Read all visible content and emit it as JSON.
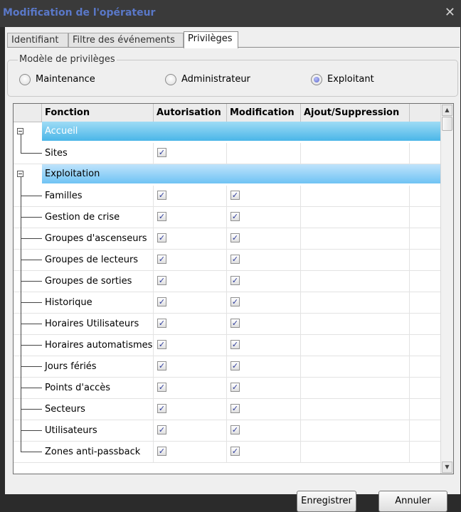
{
  "window": {
    "title": "Modification de l'opérateur"
  },
  "tabs": [
    {
      "label": "Identifiant"
    },
    {
      "label": "Filtre des événements"
    },
    {
      "label": "Privilèges"
    }
  ],
  "privileges_model": {
    "legend": "Modèle de privilèges",
    "options": [
      {
        "label": "Maintenance",
        "selected": false
      },
      {
        "label": "Administrateur",
        "selected": false
      },
      {
        "label": "Exploitant",
        "selected": true
      }
    ]
  },
  "grid": {
    "columns": [
      "Fonction",
      "Autorisation",
      "Modification",
      "Ajout/Suppression"
    ],
    "groups": [
      {
        "label": "Accueil",
        "rows": [
          {
            "name": "Sites",
            "autorisation": true,
            "modification": null
          }
        ]
      },
      {
        "label": "Exploitation",
        "rows": [
          {
            "name": "Familles",
            "autorisation": true,
            "modification": true
          },
          {
            "name": "Gestion de crise",
            "autorisation": true,
            "modification": true
          },
          {
            "name": "Groupes d'ascenseurs",
            "autorisation": true,
            "modification": true
          },
          {
            "name": "Groupes de lecteurs",
            "autorisation": true,
            "modification": true
          },
          {
            "name": "Groupes de sorties",
            "autorisation": true,
            "modification": true
          },
          {
            "name": "Historique",
            "autorisation": true,
            "modification": true
          },
          {
            "name": "Horaires Utilisateurs",
            "autorisation": true,
            "modification": true
          },
          {
            "name": "Horaires automatismes",
            "autorisation": true,
            "modification": true
          },
          {
            "name": "Jours fériés",
            "autorisation": true,
            "modification": true
          },
          {
            "name": "Points d'accès",
            "autorisation": true,
            "modification": true
          },
          {
            "name": "Secteurs",
            "autorisation": true,
            "modification": true
          },
          {
            "name": "Utilisateurs",
            "autorisation": true,
            "modification": true
          },
          {
            "name": "Zones anti-passback",
            "autorisation": true,
            "modification": true
          }
        ]
      }
    ]
  },
  "buttons": {
    "save": "Enregistrer",
    "cancel": "Annuler"
  },
  "icons": {
    "close": "close-icon",
    "check": "✓"
  },
  "colors": {
    "group_header": "#6fc3f4",
    "title": "#5a78c8",
    "radio_selected": "#5d67cc"
  }
}
